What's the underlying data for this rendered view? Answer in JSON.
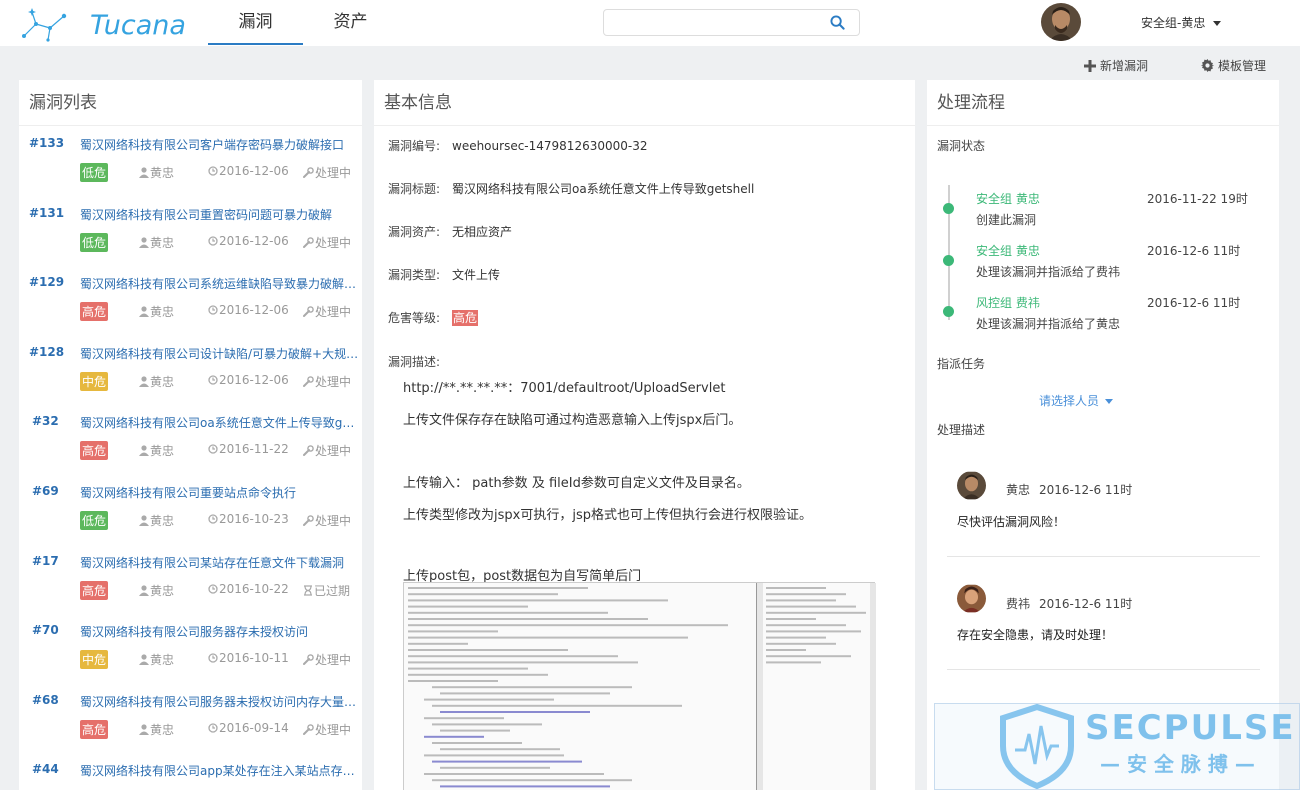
{
  "header": {
    "logo_text": "Tucana",
    "tabs": [
      {
        "label": "漏洞",
        "active": true
      },
      {
        "label": "资产",
        "active": false
      }
    ],
    "search_placeholder": "",
    "user": "安全组-黄忠"
  },
  "toolbar": {
    "add_label": "新增漏洞",
    "template_label": "模板管理"
  },
  "vuln_list": {
    "title": "漏洞列表",
    "items": [
      {
        "id": "#133",
        "title": "蜀汉网络科技有限公司客户端存密码暴力破解接口",
        "level": "低危",
        "level_type": "low",
        "owner": "黄忠",
        "date": "2016-12-06",
        "status": "处理中",
        "status_type": "processing"
      },
      {
        "id": "#131",
        "title": "蜀汉网络科技有限公司重置密码问题可暴力破解",
        "level": "低危",
        "level_type": "low",
        "owner": "黄忠",
        "date": "2016-12-06",
        "status": "处理中",
        "status_type": "processing"
      },
      {
        "id": "#129",
        "title": "蜀汉网络科技有限公司系统运维缺陷导致暴力破解（...",
        "level": "高危",
        "level_type": "high",
        "owner": "黄忠",
        "date": "2016-12-06",
        "status": "处理中",
        "status_type": "processing"
      },
      {
        "id": "#128",
        "title": "蜀汉网络科技有限公司设计缺陷/可暴力破解+大规模...",
        "level": "中危",
        "level_type": "mid",
        "owner": "黄忠",
        "date": "2016-12-06",
        "status": "处理中",
        "status_type": "processing"
      },
      {
        "id": "#32",
        "title": "蜀汉网络科技有限公司oa系统任意文件上传导致get...",
        "level": "高危",
        "level_type": "high",
        "owner": "黄忠",
        "date": "2016-11-22",
        "status": "处理中",
        "status_type": "processing"
      },
      {
        "id": "#69",
        "title": "蜀汉网络科技有限公司重要站点命令执行",
        "level": "低危",
        "level_type": "low",
        "owner": "黄忠",
        "date": "2016-10-23",
        "status": "处理中",
        "status_type": "processing"
      },
      {
        "id": "#17",
        "title": "蜀汉网络科技有限公司某站存在任意文件下载漏洞",
        "level": "高危",
        "level_type": "high",
        "owner": "黄忠",
        "date": "2016-10-22",
        "status": "已过期",
        "status_type": "expired"
      },
      {
        "id": "#70",
        "title": "蜀汉网络科技有限公司服务器存未授权访问",
        "level": "中危",
        "level_type": "mid",
        "owner": "黄忠",
        "date": "2016-10-11",
        "status": "处理中",
        "status_type": "processing"
      },
      {
        "id": "#68",
        "title": "蜀汉网络科技有限公司服务器未授权访问内存大量用...",
        "level": "高危",
        "level_type": "high",
        "owner": "黄忠",
        "date": "2016-09-14",
        "status": "处理中",
        "status_type": "processing"
      },
      {
        "id": "#44",
        "title": "蜀汉网络科技有限公司app某处存在注入某站点存在...",
        "level": "",
        "level_type": "",
        "owner": "",
        "date": "",
        "status": "",
        "status_type": ""
      }
    ]
  },
  "basic_info": {
    "title": "基本信息",
    "fields": {
      "number_label": "漏洞编号:",
      "number": "weehoursec-1479812630000-32",
      "title_label": "漏洞标题:",
      "vuln_title": "蜀汉网络科技有限公司oa系统任意文件上传导致getshell",
      "asset_label": "漏洞资产:",
      "asset": "无相应资产",
      "type_label": "漏洞类型:",
      "type": "文件上传",
      "level_label": "危害等级:",
      "level": "高危",
      "desc_label": "漏洞描述:"
    },
    "description": [
      "http://**.**.**.**：7001/defaultroot/UploadServlet",
      "上传文件保存存在缺陷可通过构造恶意输入上传jspx后门。",
      "上传输入： path参数 及 fileId参数可自定义文件及目录名。",
      "上传类型修改为jspx可执行，jsp格式也可上传但执行会进行权限验证。",
      "上传post包，post数据包为自写简单后门"
    ]
  },
  "process": {
    "title": "处理流程",
    "status_label": "漏洞状态",
    "timeline": [
      {
        "who": "安全组 黄忠",
        "time": "2016-11-22 19时",
        "action": "创建此漏洞"
      },
      {
        "who": "安全组 黄忠",
        "time": "2016-12-6 11时",
        "action": "处理该漏洞并指派给了费祎"
      },
      {
        "who": "风控组 费祎",
        "time": "2016-12-6 11时",
        "action": "处理该漏洞并指派给了黄忠"
      }
    ],
    "assign_label": "指派任务",
    "assign_select": "请选择人员",
    "desc_label": "处理描述",
    "comments": [
      {
        "author": "黄忠",
        "time": "2016-12-6 11时",
        "text": "尽快评估漏洞风险！"
      },
      {
        "author": "费祎",
        "time": "2016-12-6 11时",
        "text": "存在安全隐患，请及时处理！"
      }
    ]
  },
  "watermark": {
    "brand": "SECPULSE",
    "tagline": "— 安 全 脉 搏 —"
  },
  "colors": {
    "accent": "#2b6db0",
    "logo": "#35a3e0",
    "low": "#5cb85c",
    "mid": "#e6b83e",
    "high": "#e5706a",
    "timeline": "#3cb878"
  }
}
